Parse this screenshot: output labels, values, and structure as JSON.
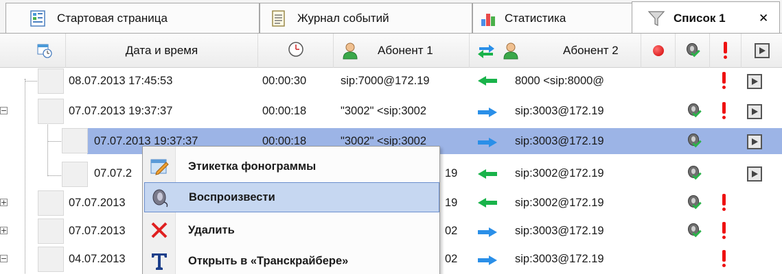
{
  "tabs": [
    {
      "label": "Стартовая страница",
      "icon": "start-page-icon"
    },
    {
      "label": "Журнал событий",
      "icon": "event-log-icon"
    },
    {
      "label": "Статистика",
      "icon": "bar-chart-icon"
    },
    {
      "label": "Список 1",
      "icon": "filter-funnel-icon",
      "active": true
    }
  ],
  "close_glyph": "✕",
  "columns": {
    "datetime": "Дата и время",
    "subscriber1": "Абонент 1",
    "subscriber2": "Абонент 2"
  },
  "rows": [
    {
      "datetime": "08.07.2013 17:45:53",
      "duration": "00:00:30",
      "sub1": "sip:7000@172.19",
      "direction": "in",
      "sub2": "8000 <sip:8000@",
      "listened": false,
      "important": true,
      "video": true
    },
    {
      "datetime": "07.07.2013 19:37:37",
      "duration": "00:00:18",
      "sub1": "\"3002\" <sip:3002",
      "direction": "out",
      "sub2": "sip:3003@172.19",
      "listened": true,
      "important": true,
      "video": true
    },
    {
      "datetime": "07.07.2013 19:37:37",
      "duration": "00:00:18",
      "sub1": "\"3002\" <sip:3002",
      "direction": "out",
      "sub2": "sip:3003@172.19",
      "listened": true,
      "important": false,
      "video": true,
      "selected": true
    },
    {
      "datetime": "07.07.2",
      "duration": "",
      "sub1": "19",
      "direction": "in",
      "sub2": "sip:3002@172.19",
      "listened": true,
      "important": false,
      "video": true
    },
    {
      "datetime": "07.07.2013",
      "duration": "",
      "sub1": "19",
      "direction": "in",
      "sub2": "sip:3002@172.19",
      "listened": true,
      "important": true,
      "video": false
    },
    {
      "datetime": "07.07.2013",
      "duration": "",
      "sub1": "02",
      "direction": "out",
      "sub2": "sip:3003@172.19",
      "listened": true,
      "important": true,
      "video": false
    },
    {
      "datetime": "04.07.2013",
      "duration": "",
      "sub1": "02",
      "direction": "out",
      "sub2": "sip:3003@172.19",
      "listened": false,
      "important": true,
      "video": false
    }
  ],
  "context_menu": [
    {
      "label": "Этикетка фонограммы",
      "icon": "edit-label-icon"
    },
    {
      "label": "Воспроизвести",
      "icon": "play-sound-icon",
      "highlighted": true
    },
    {
      "label": "Удалить",
      "icon": "delete-icon"
    },
    {
      "label": "Открыть в «Транскрайбере»",
      "icon": "transcriber-icon"
    }
  ],
  "colors": {
    "selection": "#9cb4e6",
    "menu_hover": "#c6d7f1",
    "incoming": "#19b34a",
    "outgoing": "#2a8fe8",
    "important": "#ee1111"
  }
}
